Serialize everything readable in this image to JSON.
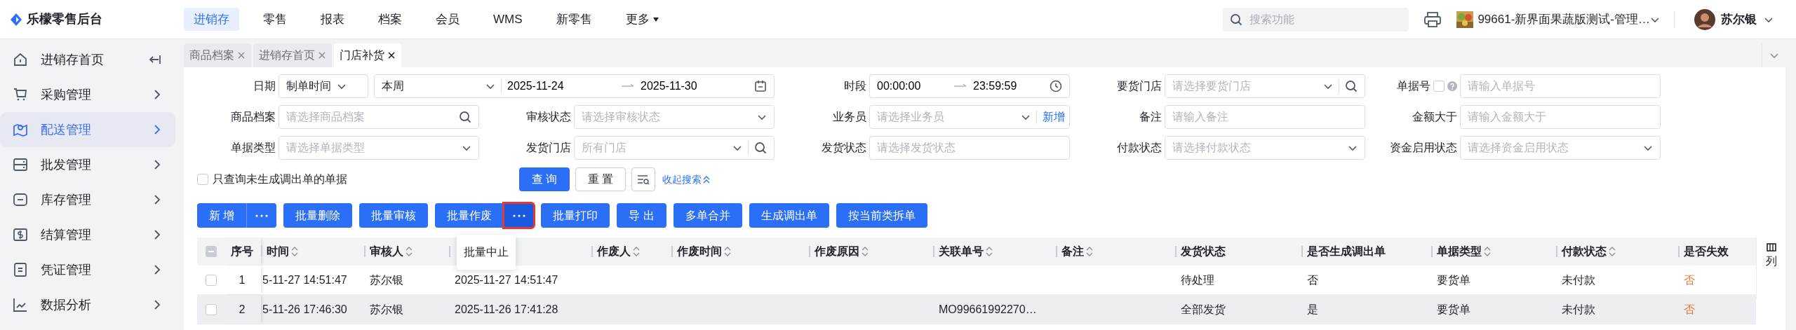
{
  "app": {
    "title": "乐檬零售后台"
  },
  "nav": [
    {
      "label": "进销存",
      "selected": true,
      "dropdown": false
    },
    {
      "label": "零售",
      "selected": false,
      "dropdown": false
    },
    {
      "label": "报表",
      "selected": false,
      "dropdown": false
    },
    {
      "label": "档案",
      "selected": false,
      "dropdown": false
    },
    {
      "label": "会员",
      "selected": false,
      "dropdown": false
    },
    {
      "label": "WMS",
      "selected": false,
      "dropdown": false
    },
    {
      "label": "新零售",
      "selected": false,
      "dropdown": false
    },
    {
      "label": "更多",
      "selected": false,
      "dropdown": true
    }
  ],
  "header": {
    "search_placeholder": "搜索功能",
    "store": "99661-新界面果蔬版测试-管理…",
    "user": "苏尔银"
  },
  "sidebar": {
    "items": [
      {
        "label": "进销存首页",
        "selected": false
      },
      {
        "label": "采购管理",
        "selected": false
      },
      {
        "label": "配送管理",
        "selected": true
      },
      {
        "label": "批发管理",
        "selected": false
      },
      {
        "label": "库存管理",
        "selected": false
      },
      {
        "label": "结算管理",
        "selected": false
      },
      {
        "label": "凭证管理",
        "selected": false
      },
      {
        "label": "数据分析",
        "selected": false
      }
    ]
  },
  "tabs": [
    {
      "label": "商品档案",
      "selected": false
    },
    {
      "label": "进销存首页",
      "selected": false
    },
    {
      "label": "门店补货",
      "selected": true
    }
  ],
  "filters": [
    {
      "label": "日期",
      "kind": "date-range",
      "mode": "制单时间",
      "preset": "本周",
      "start": "2025-11-24",
      "end": "2025-11-30"
    },
    {
      "label": "时段",
      "kind": "time-range",
      "start": "00:00:00",
      "end": "23:59:59"
    },
    {
      "label": "要货门店",
      "kind": "select-search",
      "placeholder": "请选择要货门店"
    },
    {
      "label": "单据号",
      "kind": "input",
      "checked": false,
      "help": true,
      "placeholder": "请输入单据号"
    },
    {
      "label": "商品档案",
      "kind": "search",
      "placeholder": "请选择商品档案"
    },
    {
      "label": "审核状态",
      "kind": "select",
      "placeholder": "请选择审核状态"
    },
    {
      "label": "业务员",
      "kind": "select-add",
      "placeholder": "请选择业务员",
      "action": "新增"
    },
    {
      "label": "备注",
      "kind": "input",
      "placeholder": "请输入备注"
    },
    {
      "label": "金额大于",
      "kind": "input",
      "placeholder": "请输入金额大于"
    },
    {
      "label": "单据类型",
      "kind": "select",
      "placeholder": "请选择单据类型"
    },
    {
      "label": "发货门店",
      "kind": "select-search",
      "placeholder": "所有门店"
    },
    {
      "label": "发货状态",
      "kind": "input",
      "placeholder": "请选择发货状态"
    },
    {
      "label": "付款状态",
      "kind": "select",
      "placeholder": "请选择付款状态"
    },
    {
      "label": "资金启用状态",
      "kind": "select",
      "placeholder": "请选择资金启用状态"
    }
  ],
  "only_unconverted": {
    "label": "只查询未生成调出单的单据",
    "checked": false
  },
  "search_buttons": {
    "query": "查 询",
    "reset": "重 置",
    "collapse": "收起搜索"
  },
  "toolbar": [
    {
      "label": "新 增",
      "kind": "split",
      "highlighted": false,
      "menu_open": false
    },
    {
      "label": "批量删除",
      "kind": "plain"
    },
    {
      "label": "批量审核",
      "kind": "plain"
    },
    {
      "label": "批量作废",
      "kind": "split",
      "highlighted": true,
      "menu_open": true,
      "menu_items": [
        "批量中止"
      ]
    },
    {
      "label": "批量打印",
      "kind": "plain"
    },
    {
      "label": "导 出",
      "kind": "plain"
    },
    {
      "label": "多单合并",
      "kind": "plain"
    },
    {
      "label": "生成调出单",
      "kind": "plain"
    },
    {
      "label": "按当前类拆单",
      "kind": "plain"
    }
  ],
  "table": {
    "columns": [
      {
        "label": "序号",
        "sort": false,
        "kind": "index"
      },
      {
        "label": "时间",
        "sort": true,
        "kind": "text"
      },
      {
        "label": "审核人",
        "sort": true,
        "kind": "text"
      },
      {
        "sort": false,
        "kind": "text"
      },
      {
        "label": "作废人",
        "sort": true,
        "kind": "text"
      },
      {
        "label": "作废时间",
        "sort": true,
        "kind": "text"
      },
      {
        "label": "作废原因",
        "sort": true,
        "kind": "text"
      },
      {
        "label": "关联单号",
        "sort": true,
        "kind": "text"
      },
      {
        "label": "备注",
        "sort": true,
        "kind": "text"
      },
      {
        "label": "发货状态",
        "sort": false,
        "kind": "text"
      },
      {
        "label": "是否生成调出单",
        "sort": false,
        "kind": "text"
      },
      {
        "label": "单据类型",
        "sort": true,
        "kind": "text"
      },
      {
        "label": "付款状态",
        "sort": true,
        "kind": "text"
      },
      {
        "label": "是否失效",
        "sort": false,
        "kind": "warn"
      }
    ],
    "column_settings": "列",
    "select_all_disabled": true,
    "rows": [
      {
        "checked": false,
        "hovered": false,
        "cells": [
          "1",
          "5-11-27 14:51:47",
          "苏尔银",
          "2025-11-27 14:51:47",
          "",
          "",
          "",
          "",
          "",
          "待处理",
          "否",
          "要货单",
          "未付款",
          "否"
        ]
      },
      {
        "checked": false,
        "hovered": true,
        "cells": [
          "2",
          "5-11-26 17:46:30",
          "苏尔银",
          "2025-11-26 17:41:28",
          "",
          "",
          "",
          "MO99661992270…",
          "",
          "全部发货",
          "是",
          "要货单",
          "未付款",
          "否"
        ]
      }
    ]
  }
}
